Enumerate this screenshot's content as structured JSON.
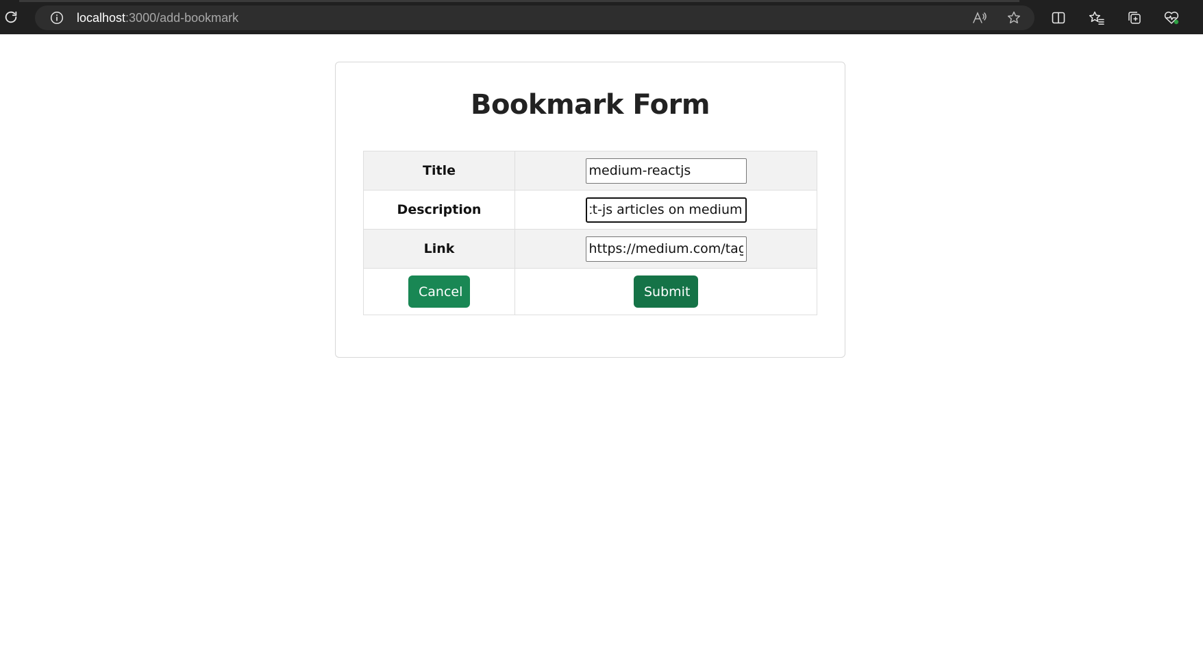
{
  "browser": {
    "url_host": "localhost",
    "url_rest": ":3000/add-bookmark",
    "icons": [
      "reload-icon",
      "site-info-icon",
      "read-aloud-icon",
      "favorite-star-icon",
      "split-screen-icon",
      "favorites-icon",
      "collections-icon",
      "browser-essentials-icon"
    ]
  },
  "form": {
    "title": "Bookmark Form",
    "rows": [
      {
        "label": "Title",
        "value": "medium-reactjs"
      },
      {
        "label": "Description",
        "value": "react-js articles on medium"
      },
      {
        "label": "Link",
        "value": "https://medium.com/tag/"
      }
    ],
    "cancel_label": "Cancel",
    "submit_label": "Submit"
  },
  "colors": {
    "chrome_bg": "#202020",
    "address_bg": "#2e2e2e",
    "cancel_button": "#198754",
    "submit_button": "#157347",
    "row_stripe": "#f2f2f2"
  }
}
